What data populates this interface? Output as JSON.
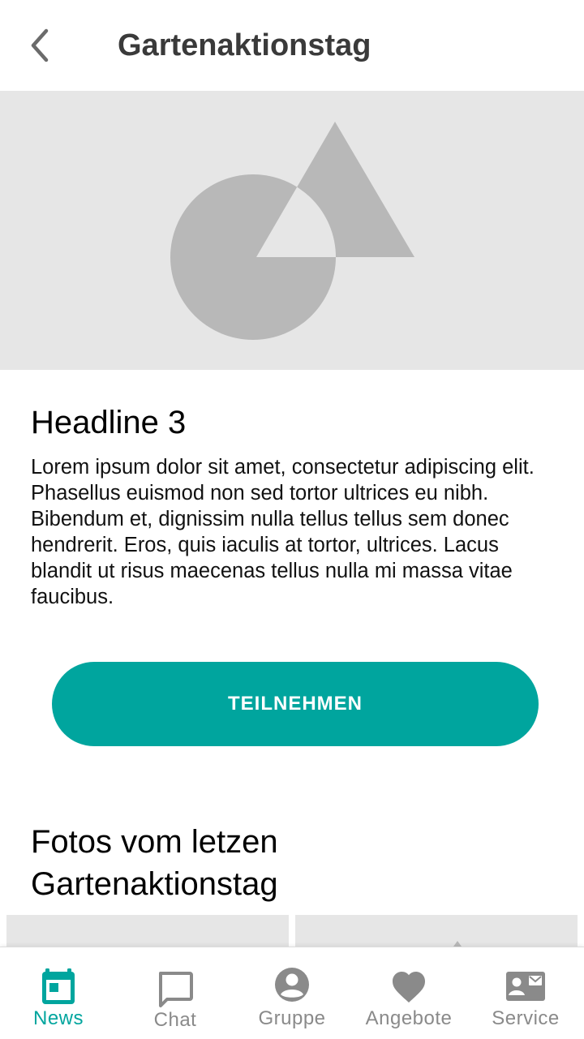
{
  "app_bar": {
    "title": "Gartenaktionstag",
    "back_icon": "chevron-left-icon"
  },
  "hero": {
    "placeholder_icon": "image-placeholder-icon"
  },
  "article": {
    "headline": "Headline 3",
    "body": "Lorem ipsum dolor sit amet, consectetur adipiscing elit. Phasellus euismod non sed tortor ultrices eu nibh. Bibendum et, dignissim nulla tellus tellus sem donec hendrerit. Eros, quis iaculis at tortor, ultrices. Lacus blandit ut risus maecenas tellus nulla mi massa vitae faucibus."
  },
  "cta": {
    "label": "TEILNEHMEN"
  },
  "photos": {
    "title": "Fotos vom letzen Gartenaktionstag"
  },
  "bottom_nav": {
    "active": "News",
    "items": [
      {
        "label": "News",
        "icon": "calendar-icon"
      },
      {
        "label": "Chat",
        "icon": "chat-bubble-icon"
      },
      {
        "label": "Gruppe",
        "icon": "account-circle-icon"
      },
      {
        "label": "Angebote",
        "icon": "heart-icon"
      },
      {
        "label": "Service",
        "icon": "contact-mail-icon"
      }
    ]
  },
  "colors": {
    "accent": "#00a59e",
    "placeholder_bg": "#e6e6e6",
    "placeholder_shape": "#b8b8b8",
    "inactive_nav": "#8a8a8a",
    "title_text": "#3a3a3a"
  }
}
